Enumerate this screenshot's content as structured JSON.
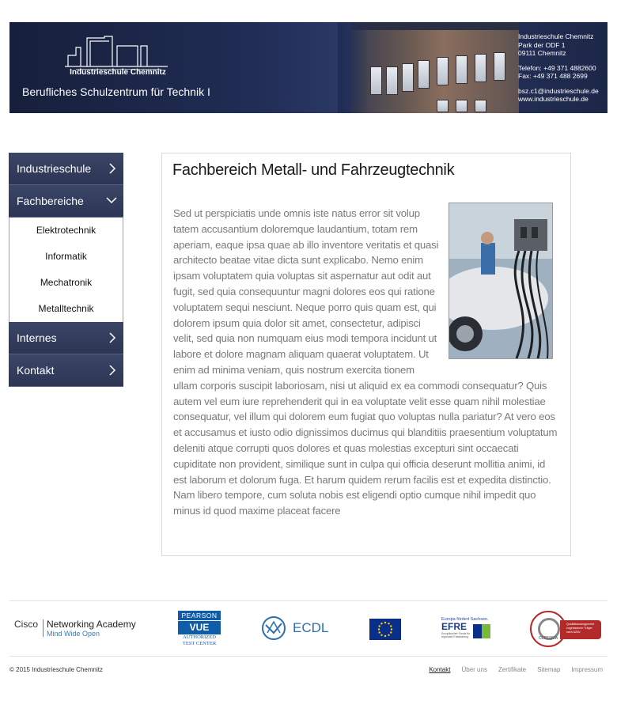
{
  "header": {
    "logo_name": "Industrieschule Chemnitz",
    "school_title": "Berufliches Schulzentrum für Technik I",
    "contact": {
      "name": "Industrieschule Chemnitz",
      "street": "Park der ODF 1",
      "city": "09111 Chemnitz",
      "phone": "Telefon: +49 371 4882600",
      "fax": "Fax: +49 371 488 2699",
      "email": "bsz.c1@industrieschule.de",
      "web": "www.industrieschule.de"
    }
  },
  "sidebar": {
    "items": [
      {
        "label": "Industrieschule",
        "icon": "chevron-right-icon"
      },
      {
        "label": "Fachbereiche",
        "icon": "chevron-down-icon",
        "expanded": true
      },
      {
        "label": "Internes",
        "icon": "chevron-right-icon"
      },
      {
        "label": "Kontakt",
        "icon": "chevron-right-icon"
      }
    ],
    "subitems": [
      "Elektrotechnik",
      "Informatik",
      "Mechatronik",
      "Metalltechnik"
    ]
  },
  "main": {
    "title": "Fachbereich Metall- und Fahrzeugtechnik",
    "body": "Sed ut perspiciatis unde omnis iste natus error sit volup tatem accusantium doloremque laudantium, totam rem aperiam, eaque ipsa quae ab illo inventore veritatis et quasi architecto beatae vitae dicta sunt explicabo. Nemo enim ipsam voluptatem quia voluptas sit aspernatur aut odit aut fugit, sed quia consequuntur magni dolores eos qui ratione voluptatem sequi nesciunt. Neque porro quis quam est, qui dolorem ipsum quia dolor sit amet, consectetur, adipisci velit, sed quia non numquam eius modi tempora incidunt ut labore et dolore magnam aliquam quaerat voluptatem. Ut enim ad minima veniam, quis nostrum exercita tionem ullam corporis suscipit laboriosam, nisi ut aliquid ex ea commodi consequatur? Quis autem vel eum iure reprehenderit qui in ea voluptate velit esse quam nihil molestiae consequatur, vel illum qui dolorem eum fugiat quo voluptas nulla pariatur? At vero eos et accusamus et iusto odio dignissimos ducimus qui blanditiis praesentium voluptatum deleniti atque corrupti quos dolores et quas molestias excepturi sint occaecati cupiditate non provident, similique sunt in culpa qui officia deserunt mollitia animi, id est laborum et dolorum fuga. Et harum quidem rerum facilis est et expedita distinctio. Nam libero tempore, cum soluta nobis est eligendi optio cumque nihil impedit quo minus id quod maxime placeat facere"
  },
  "partners": {
    "cisco": {
      "name": "Cisco",
      "line1": "Networking Academy",
      "tagline": "Mind Wide Open"
    },
    "pearson": {
      "top": "PEARSON",
      "mid": "VUE",
      "bottom1": "AUTHORIZED",
      "bottom2": "TEST CENTER"
    },
    "ecdl": {
      "name": "ECDL"
    },
    "efre": {
      "top": "Europa fördert Sachsen.",
      "name": "EFRE",
      "small": "Europäischer Fonds für regionale Entwicklung"
    },
    "certqua": {
      "name": "CERTQUA",
      "badge1": "Qualitätsmanagement",
      "badge2": "zugelassener Träger",
      "badge3": "nach AZAV"
    }
  },
  "footer": {
    "copyright": "© 2015 Industrieschule Chemnitz",
    "links": [
      "Kontakt",
      "Über uns",
      "Zertifikate",
      "Sitemap",
      "Impressum"
    ]
  },
  "colors": {
    "banner": "#202c54",
    "nav": "#34405f",
    "body_text": "#7a7a7a",
    "eu_blue": "#0a2f8a",
    "ecdl_blue": "#2a6fb0"
  }
}
